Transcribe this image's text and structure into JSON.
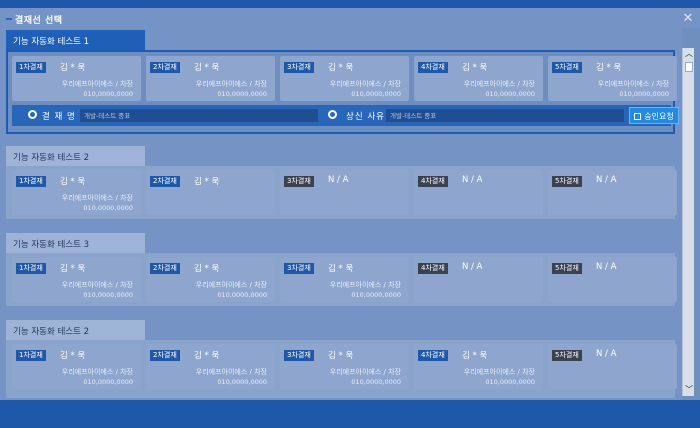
{
  "dialog": {
    "title": "결재선 선택",
    "close": "✕"
  },
  "sections": [
    {
      "tab": "기능 자동화 테스트 1",
      "steps": [
        {
          "badge": "1차결재",
          "approver": "김 * 욱",
          "dept": "우리에프아이에스 /  차장",
          "emp": "010,0000,0000"
        },
        {
          "badge": "2차결재",
          "approver": "김 * 욱",
          "dept": "우리에프아이에스 /  차장",
          "emp": "010,0000,0000"
        },
        {
          "badge": "3차결재",
          "approver": "김 * 욱",
          "dept": "우리에프아이에스 /  차장",
          "emp": "010,0000,0000"
        },
        {
          "badge": "4차결재",
          "approver": "김 * 욱",
          "dept": "우리에프아이에스 /  차장",
          "emp": "010,0000,0000"
        },
        {
          "badge": "5차결재",
          "approver": "김 * 욱",
          "dept": "우리에프아이에스 /  차장",
          "emp": "010,0000,0000"
        }
      ],
      "form": {
        "title_label": "결 재 명",
        "title_placeholder": "개발-테스트 중표",
        "reason_label": "상신 사유",
        "reason_placeholder": "개발-테스트 중표",
        "approve_button": "승인요청"
      }
    },
    {
      "tab": "기능 자동화 테스트 2",
      "steps": [
        {
          "badge": "1차결재",
          "approver": "김 * 욱",
          "dept": "우리에프아이에스 /  차장",
          "emp": "010,0000,0000"
        },
        {
          "badge": "2차결재",
          "approver": "김 * 욱",
          "dept": "",
          "emp": ""
        },
        {
          "badge": "3차결재",
          "approver": "N / A",
          "dept": "",
          "emp": ""
        },
        {
          "badge": "4차결재",
          "approver": "N / A",
          "dept": "",
          "emp": ""
        },
        {
          "badge": "5차결재",
          "approver": "N / A",
          "dept": "",
          "emp": ""
        }
      ]
    },
    {
      "tab": "기능 자동화 테스트 3",
      "steps": [
        {
          "badge": "1차결재",
          "approver": "김 * 욱",
          "dept": "우리에프아이에스 /  차장",
          "emp": "010,0000,0000"
        },
        {
          "badge": "2차결재",
          "approver": "김 * 욱",
          "dept": "우리에프아이에스 /  차장",
          "emp": "010,0000,0000"
        },
        {
          "badge": "3차결재",
          "approver": "김 * 욱",
          "dept": "우리에프아이에스 /  차장",
          "emp": "010,0000,0000"
        },
        {
          "badge": "4차결재",
          "approver": "N / A",
          "dept": "",
          "emp": ""
        },
        {
          "badge": "5차결재",
          "approver": "N / A",
          "dept": "",
          "emp": ""
        }
      ]
    },
    {
      "tab": "기능 자동화 테스트 2",
      "steps": [
        {
          "badge": "1차결재",
          "approver": "김 * 욱",
          "dept": "우리에프아이에스 /  차장",
          "emp": "010,0000,0000"
        },
        {
          "badge": "2차결재",
          "approver": "김 * 욱",
          "dept": "우리에프아이에스 /  차장",
          "emp": "010,0000,0000"
        },
        {
          "badge": "3차결재",
          "approver": "김 * 욱",
          "dept": "우리에프아이에스 /  차장",
          "emp": "010,0000,0000"
        },
        {
          "badge": "4차결재",
          "approver": "김 * 욱",
          "dept": "우리에프아이에스 /  차장",
          "emp": "010,0000,0000"
        },
        {
          "badge": "5차결재",
          "approver": "N / A",
          "dept": "",
          "emp": ""
        }
      ]
    }
  ],
  "scrollbar": {
    "up": "︿",
    "down": "﹀"
  },
  "colors": {
    "accent": "#1f58a8",
    "panel": "#7593c4",
    "badge_inactive": "#3a4150",
    "button": "#238ae0"
  }
}
